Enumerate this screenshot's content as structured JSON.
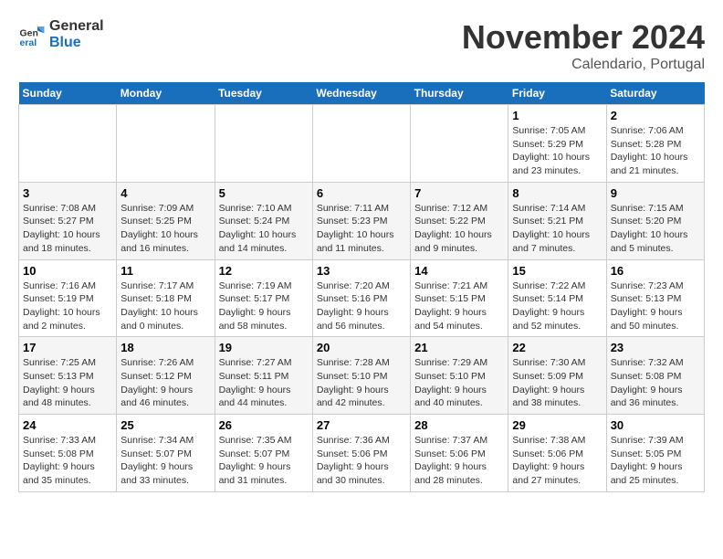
{
  "header": {
    "logo_line1": "General",
    "logo_line2": "Blue",
    "month_title": "November 2024",
    "subtitle": "Calendario, Portugal"
  },
  "calendar": {
    "days_of_week": [
      "Sunday",
      "Monday",
      "Tuesday",
      "Wednesday",
      "Thursday",
      "Friday",
      "Saturday"
    ],
    "weeks": [
      [
        {
          "day": "",
          "info": ""
        },
        {
          "day": "",
          "info": ""
        },
        {
          "day": "",
          "info": ""
        },
        {
          "day": "",
          "info": ""
        },
        {
          "day": "",
          "info": ""
        },
        {
          "day": "1",
          "info": "Sunrise: 7:05 AM\nSunset: 5:29 PM\nDaylight: 10 hours and 23 minutes."
        },
        {
          "day": "2",
          "info": "Sunrise: 7:06 AM\nSunset: 5:28 PM\nDaylight: 10 hours and 21 minutes."
        }
      ],
      [
        {
          "day": "3",
          "info": "Sunrise: 7:08 AM\nSunset: 5:27 PM\nDaylight: 10 hours and 18 minutes."
        },
        {
          "day": "4",
          "info": "Sunrise: 7:09 AM\nSunset: 5:25 PM\nDaylight: 10 hours and 16 minutes."
        },
        {
          "day": "5",
          "info": "Sunrise: 7:10 AM\nSunset: 5:24 PM\nDaylight: 10 hours and 14 minutes."
        },
        {
          "day": "6",
          "info": "Sunrise: 7:11 AM\nSunset: 5:23 PM\nDaylight: 10 hours and 11 minutes."
        },
        {
          "day": "7",
          "info": "Sunrise: 7:12 AM\nSunset: 5:22 PM\nDaylight: 10 hours and 9 minutes."
        },
        {
          "day": "8",
          "info": "Sunrise: 7:14 AM\nSunset: 5:21 PM\nDaylight: 10 hours and 7 minutes."
        },
        {
          "day": "9",
          "info": "Sunrise: 7:15 AM\nSunset: 5:20 PM\nDaylight: 10 hours and 5 minutes."
        }
      ],
      [
        {
          "day": "10",
          "info": "Sunrise: 7:16 AM\nSunset: 5:19 PM\nDaylight: 10 hours and 2 minutes."
        },
        {
          "day": "11",
          "info": "Sunrise: 7:17 AM\nSunset: 5:18 PM\nDaylight: 10 hours and 0 minutes."
        },
        {
          "day": "12",
          "info": "Sunrise: 7:19 AM\nSunset: 5:17 PM\nDaylight: 9 hours and 58 minutes."
        },
        {
          "day": "13",
          "info": "Sunrise: 7:20 AM\nSunset: 5:16 PM\nDaylight: 9 hours and 56 minutes."
        },
        {
          "day": "14",
          "info": "Sunrise: 7:21 AM\nSunset: 5:15 PM\nDaylight: 9 hours and 54 minutes."
        },
        {
          "day": "15",
          "info": "Sunrise: 7:22 AM\nSunset: 5:14 PM\nDaylight: 9 hours and 52 minutes."
        },
        {
          "day": "16",
          "info": "Sunrise: 7:23 AM\nSunset: 5:13 PM\nDaylight: 9 hours and 50 minutes."
        }
      ],
      [
        {
          "day": "17",
          "info": "Sunrise: 7:25 AM\nSunset: 5:13 PM\nDaylight: 9 hours and 48 minutes."
        },
        {
          "day": "18",
          "info": "Sunrise: 7:26 AM\nSunset: 5:12 PM\nDaylight: 9 hours and 46 minutes."
        },
        {
          "day": "19",
          "info": "Sunrise: 7:27 AM\nSunset: 5:11 PM\nDaylight: 9 hours and 44 minutes."
        },
        {
          "day": "20",
          "info": "Sunrise: 7:28 AM\nSunset: 5:10 PM\nDaylight: 9 hours and 42 minutes."
        },
        {
          "day": "21",
          "info": "Sunrise: 7:29 AM\nSunset: 5:10 PM\nDaylight: 9 hours and 40 minutes."
        },
        {
          "day": "22",
          "info": "Sunrise: 7:30 AM\nSunset: 5:09 PM\nDaylight: 9 hours and 38 minutes."
        },
        {
          "day": "23",
          "info": "Sunrise: 7:32 AM\nSunset: 5:08 PM\nDaylight: 9 hours and 36 minutes."
        }
      ],
      [
        {
          "day": "24",
          "info": "Sunrise: 7:33 AM\nSunset: 5:08 PM\nDaylight: 9 hours and 35 minutes."
        },
        {
          "day": "25",
          "info": "Sunrise: 7:34 AM\nSunset: 5:07 PM\nDaylight: 9 hours and 33 minutes."
        },
        {
          "day": "26",
          "info": "Sunrise: 7:35 AM\nSunset: 5:07 PM\nDaylight: 9 hours and 31 minutes."
        },
        {
          "day": "27",
          "info": "Sunrise: 7:36 AM\nSunset: 5:06 PM\nDaylight: 9 hours and 30 minutes."
        },
        {
          "day": "28",
          "info": "Sunrise: 7:37 AM\nSunset: 5:06 PM\nDaylight: 9 hours and 28 minutes."
        },
        {
          "day": "29",
          "info": "Sunrise: 7:38 AM\nSunset: 5:06 PM\nDaylight: 9 hours and 27 minutes."
        },
        {
          "day": "30",
          "info": "Sunrise: 7:39 AM\nSunset: 5:05 PM\nDaylight: 9 hours and 25 minutes."
        }
      ]
    ]
  }
}
